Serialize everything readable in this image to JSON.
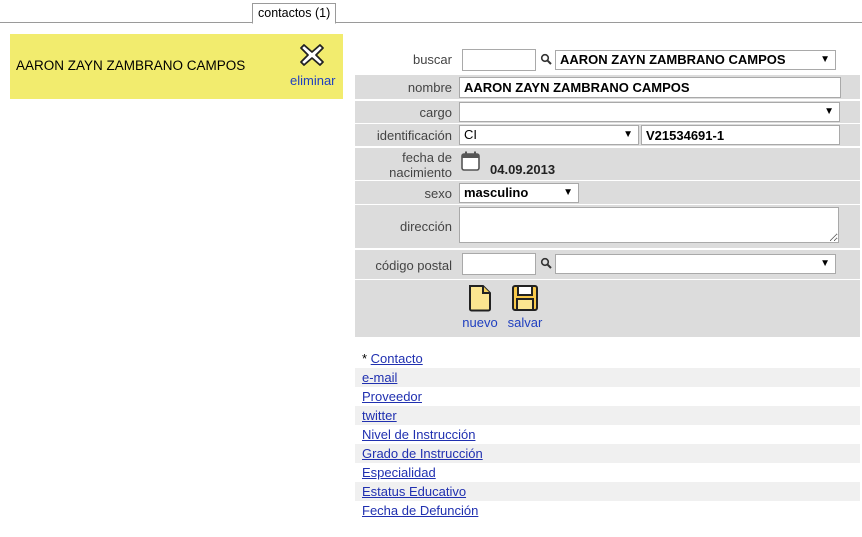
{
  "tab": {
    "label": "contactos (1)"
  },
  "card": {
    "name": "AARON ZAYN ZAMBRANO CAMPOS",
    "delete_label": "eliminar",
    "delete_icon": "cross-icon"
  },
  "search": {
    "label": "buscar",
    "value": "",
    "selected": "AARON ZAYN ZAMBRANO CAMPOS"
  },
  "form": {
    "nombre": {
      "label": "nombre",
      "value": "AARON ZAYN ZAMBRANO CAMPOS"
    },
    "cargo": {
      "label": "cargo",
      "value": ""
    },
    "identificacion": {
      "label": "identificación",
      "type": "CI",
      "value": "V21534691-1"
    },
    "nacimiento": {
      "label_line1": "fecha de",
      "label_line2": "nacimiento",
      "value": "04.09.2013"
    },
    "sexo": {
      "label": "sexo",
      "value": "masculino"
    },
    "direccion": {
      "label": "dirección",
      "value": ""
    },
    "postal": {
      "label": "código postal",
      "value": "",
      "selected": ""
    }
  },
  "actions": {
    "new_label": "nuevo",
    "save_label": "salvar"
  },
  "links": {
    "prefix": "* ",
    "items": [
      "Contacto",
      "e-mail",
      "Proveedor",
      "twitter",
      "Nivel de Instrucción",
      "Grado de Instrucción",
      "Especialidad",
      "Estatus Educativo",
      "Fecha de Defunción"
    ]
  },
  "colors": {
    "card_bg": "#f2ec6e",
    "row_bg": "#dcdcdc",
    "link": "#2030b0"
  }
}
